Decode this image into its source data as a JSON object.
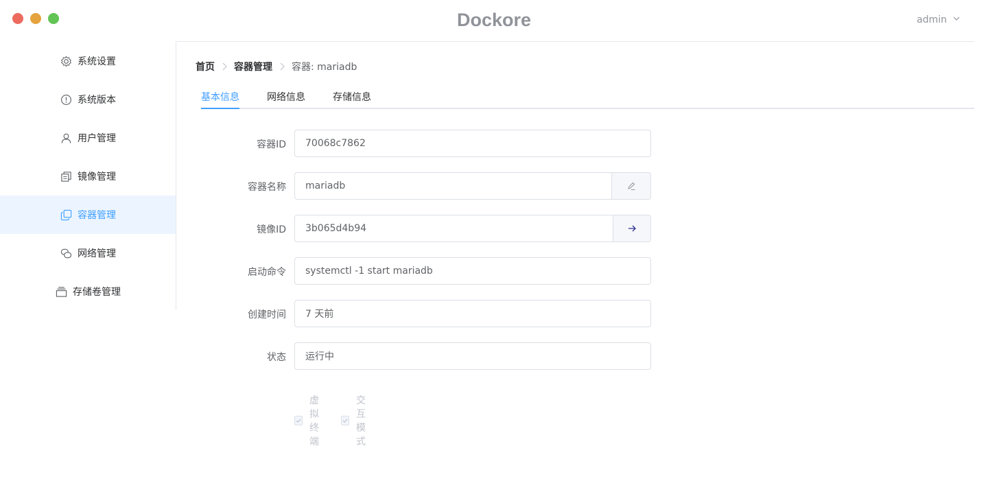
{
  "window": {
    "title": "Dockore"
  },
  "header": {
    "user": "admin"
  },
  "sidebar": {
    "items": [
      {
        "label": "系统设置",
        "icon": "gear-icon"
      },
      {
        "label": "系统版本",
        "icon": "info-icon"
      },
      {
        "label": "用户管理",
        "icon": "user-icon"
      },
      {
        "label": "镜像管理",
        "icon": "files-icon"
      },
      {
        "label": "容器管理",
        "icon": "copy-icon",
        "active": true
      },
      {
        "label": "网络管理",
        "icon": "chat-icon"
      },
      {
        "label": "存储卷管理",
        "icon": "box-icon"
      }
    ]
  },
  "breadcrumb": {
    "home": "首页",
    "section": "容器管理",
    "current": "容器: mariadb"
  },
  "tabs": [
    {
      "label": "基本信息",
      "active": true
    },
    {
      "label": "网络信息"
    },
    {
      "label": "存储信息"
    }
  ],
  "form": {
    "container_id": {
      "label": "容器ID",
      "value": "70068c7862"
    },
    "container_name": {
      "label": "容器名称",
      "value": "mariadb"
    },
    "image_id": {
      "label": "镜像ID",
      "value": "3b065d4b94"
    },
    "command": {
      "label": "启动命令",
      "value": "systemctl -1 start mariadb"
    },
    "created": {
      "label": "创建时间",
      "value": "7 天前"
    },
    "status": {
      "label": "状态",
      "value": "运行中"
    }
  },
  "options": {
    "tty": {
      "label": "虚拟终端",
      "checked": true,
      "disabled": true
    },
    "interactive": {
      "label": "交互模式",
      "checked": true,
      "disabled": true
    }
  },
  "colors": {
    "accent": "#409eff",
    "active_bg": "#ecf5ff",
    "title": "#909399"
  }
}
